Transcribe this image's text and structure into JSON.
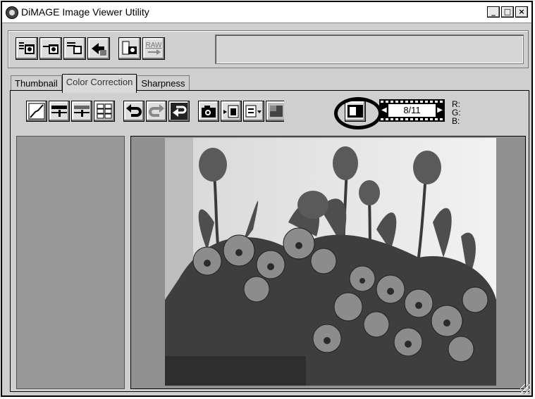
{
  "window": {
    "title": "DiMAGE Image Viewer Utility",
    "controls": {
      "minimize": "_",
      "maximize": "□",
      "close": "×"
    }
  },
  "toolbar": {
    "raw_label": "RAW"
  },
  "tabs": [
    {
      "label": "Thumbnail",
      "active": false
    },
    {
      "label": "Color Correction",
      "active": true
    },
    {
      "label": "Sharpness",
      "active": false
    }
  ],
  "frame_nav": {
    "counter": "8/11"
  },
  "rgb": {
    "r": "R:",
    "g": "G:",
    "b": "B:"
  },
  "colors": {
    "highlight_ring": "#000000",
    "panel_bg": "#cfcfcf",
    "pane_bg": "#989898"
  }
}
